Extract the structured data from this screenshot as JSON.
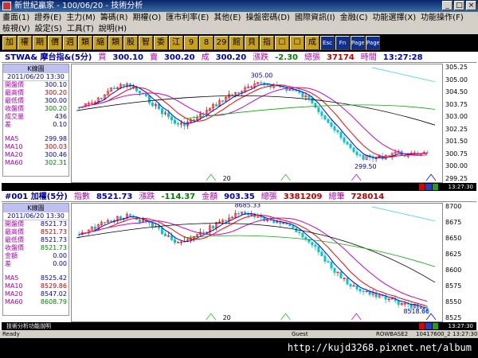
{
  "window": {
    "title": "新世紀贏家 - 100/06/20 - 技術分析"
  },
  "menu1": [
    "畫面(1)",
    "證券(E)",
    "主力(M)",
    "籌碼(R)",
    "期權(O)",
    "匯市利率(E)",
    "其他(E)",
    "操盤密碼(D)",
    "國際資訊(I)",
    "金融(C)",
    "功能選擇(X)",
    "功能操作(F)"
  ],
  "menu2": [
    "檢視(V)",
    "設定(S)",
    "工具(T)",
    "說明(H)"
  ],
  "toolbar": [
    "加",
    "權",
    "期",
    "價",
    "週",
    "類",
    "縮",
    "類",
    "股",
    "智",
    "委",
    "江",
    "9",
    "8",
    "29",
    "館",
    "貝",
    "指",
    "☐",
    "☐",
    "成"
  ],
  "toolbar_blue": [
    "Esc",
    "Fn",
    "Page Up",
    "Page Dn"
  ],
  "panel1": {
    "symbol": "STWA& 摩台指&(5分)",
    "buy_label": "買",
    "buy": "300.10",
    "sell_label": "賣",
    "sell": "300.20",
    "deal_label": "成",
    "deal": "300.20",
    "change_label": "漲跌",
    "change": "-2.30",
    "vol_label": "總張",
    "vol": "37174",
    "time_label": "時間",
    "time": "13:27:28",
    "kchart": "K線圖",
    "date": "2011/06/20 13:30",
    "rows": [
      {
        "k": "開盤價",
        "v": "300.10"
      },
      {
        "k": "最高價",
        "v": "300.20"
      },
      {
        "k": "最低價",
        "v": "300.00"
      },
      {
        "k": "收盤價",
        "v": "300.20"
      },
      {
        "k": "成交量",
        "v": "436"
      },
      {
        "k": "差",
        "v": "0.10"
      }
    ],
    "ma": [
      {
        "k": "MA5",
        "v": "299.98"
      },
      {
        "k": "MA10",
        "v": "300.03"
      },
      {
        "k": "MA20",
        "v": "300.46"
      },
      {
        "k": "MA60",
        "v": "302.31"
      }
    ],
    "axis": [
      "305.25",
      "305.00",
      "304.50",
      "303.75",
      "303.00",
      "302.25",
      "301.50",
      "300.75",
      "300.00",
      "299.25"
    ],
    "hi_note": "305.00",
    "lo_note": "299.50",
    "xlabel": "20"
  },
  "panel2": {
    "symbol": "#001 加權(5分)",
    "idx_label": "指數",
    "idx": "8521.73",
    "change_label": "漲跌",
    "change": "-114.37",
    "amt_label": "金額",
    "amt": "903.35",
    "vol_label": "總張",
    "vol": "3381209",
    "cnt_label": "總筆",
    "cnt": "728014",
    "kchart": "K線圖",
    "date": "2011/06/20 13:30",
    "rows": [
      {
        "k": "開盤價",
        "v": "8521.73"
      },
      {
        "k": "最高價",
        "v": "8521.73"
      },
      {
        "k": "最低價",
        "v": "8521.73"
      },
      {
        "k": "收盤價",
        "v": "8521.73"
      },
      {
        "k": "金額",
        "v": "0.00"
      },
      {
        "k": "差",
        "v": "0.00"
      }
    ],
    "ma": [
      {
        "k": "MA5",
        "v": "8525.42"
      },
      {
        "k": "MA10",
        "v": "8529.86"
      },
      {
        "k": "MA20",
        "v": "8547.02"
      },
      {
        "k": "MA60",
        "v": "8608.79"
      }
    ],
    "axis": [
      "8700",
      "8675",
      "8650",
      "8625",
      "8600",
      "8575",
      "8550",
      "8525"
    ],
    "hi_note": "8685.33",
    "lo_note": "8518.66",
    "xlabel": "20"
  },
  "foot1_time": "13:27:30",
  "foot2_time": "13:27:30",
  "foot2_text": "技術分析功能說明",
  "status": {
    "left": "Ready",
    "guest": "Guest",
    "server": "ROWBASE2",
    "id": "10417600_2",
    "time": "13:27:30"
  },
  "watermark": "http://kujd3268.pixnet.net/album",
  "colors": {
    "ma5": "#0000ff",
    "ma10": "#ff0000",
    "ma20": "#cc00cc",
    "ma60": "#00b000",
    "trend": "#000000",
    "up": "#ff0000",
    "down": "#00c8c8"
  }
}
